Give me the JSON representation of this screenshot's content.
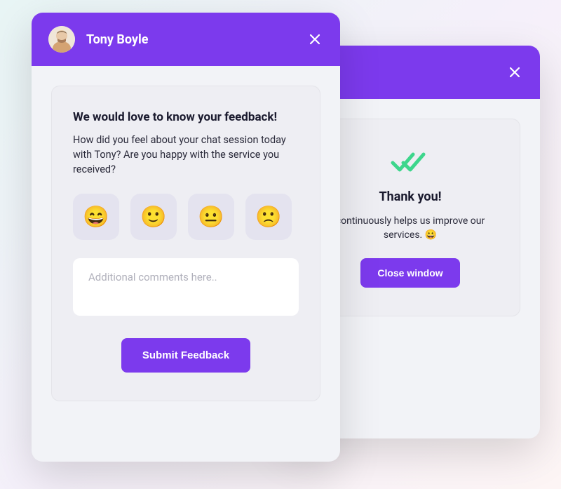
{
  "agent_name": "Tony Boyle",
  "agent_name_suffix": "le",
  "feedback": {
    "title": "We would love to know your feedback!",
    "subtitle": "How did you feel about your chat session today with Tony? Are you happy with the service you received?",
    "emoji_options": [
      "😄",
      "🙂",
      "😐",
      "🙁"
    ],
    "comment_placeholder": "Additional comments here..",
    "submit_label": "Submit Feedback"
  },
  "confirmation": {
    "title": "Thank you!",
    "text_fragment": "continuously helps us improve our services. 😀",
    "close_label": "Close window"
  }
}
